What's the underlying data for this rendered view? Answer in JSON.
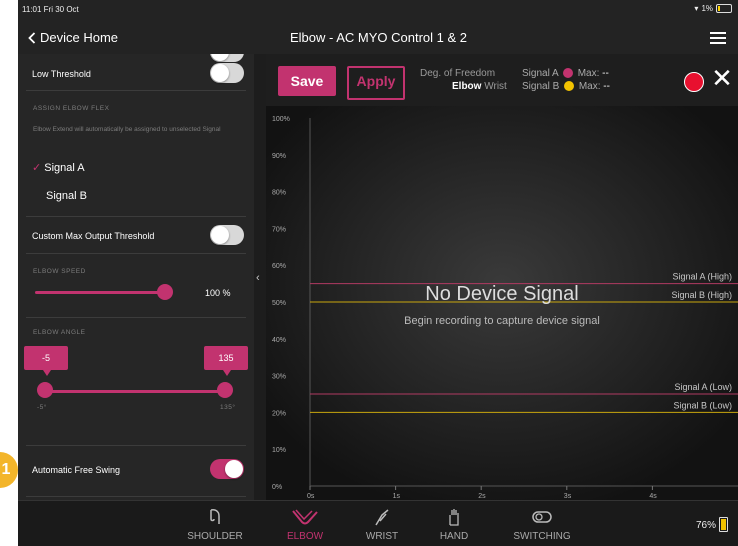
{
  "statusbar": {
    "time": "11:01  Fri 30 Oct",
    "battery": "1%"
  },
  "nav": {
    "back_label": "Device Home",
    "title": "Elbow - AC MYO Control 1 & 2"
  },
  "sidebar": {
    "low_threshold_label": "Low Threshold",
    "assign_header": "ASSIGN ELBOW FLEX",
    "assign_note": "Elbow Extend will automatically be assigned to unselected Signal",
    "signal_a_label": "Signal A",
    "signal_b_label": "Signal B",
    "custom_max_label": "Custom Max Output Threshold",
    "speed_header": "ELBOW SPEED",
    "speed_value": "100 %",
    "speed_level": 1.0,
    "angle_header": "ELBOW ANGLE",
    "angle_min_value": "-5",
    "angle_max_value": "135",
    "angle_min_scale": "-5°",
    "angle_max_scale": "135°",
    "free_swing_label": "Automatic Free Swing"
  },
  "toolbar": {
    "save_label": "Save",
    "apply_label": "Apply",
    "dof_label": "Deg. of Freedom",
    "dof_elbow": "Elbow",
    "dof_wrist": "Wrist",
    "signal_a": "Signal A",
    "signal_b": "Signal B",
    "max_label": "Max:",
    "max_a": "--",
    "max_b": "--"
  },
  "chart_data": {
    "type": "line",
    "y_ticks": [
      "100%",
      "90%",
      "80%",
      "70%",
      "60%",
      "50%",
      "40%",
      "30%",
      "20%",
      "10%",
      "0%"
    ],
    "x_ticks": [
      "0s",
      "1s",
      "2s",
      "3s",
      "4s"
    ],
    "ylim": [
      0,
      100
    ],
    "xlim": [
      0,
      5
    ],
    "message": "No Device Signal",
    "submessage": "Begin recording to capture device signal",
    "thresholds": [
      {
        "name": "Signal A (High)",
        "value": 55,
        "color": "#b03a62"
      },
      {
        "name": "Signal B (High)",
        "value": 50,
        "color": "#c9a70e"
      },
      {
        "name": "Signal A (Low)",
        "value": 25,
        "color": "#b03a62"
      },
      {
        "name": "Signal B (Low)",
        "value": 20,
        "color": "#c9a70e"
      }
    ]
  },
  "tabs": [
    "SHOULDER",
    "ELBOW",
    "WRIST",
    "HAND",
    "SWITCHING"
  ],
  "tabbar": {
    "battery": "76%"
  },
  "callout": "1",
  "colors": {
    "accent": "#c2336f",
    "signal_a": "#c2336f",
    "signal_b": "#f2c200",
    "record": "#e8102f"
  }
}
